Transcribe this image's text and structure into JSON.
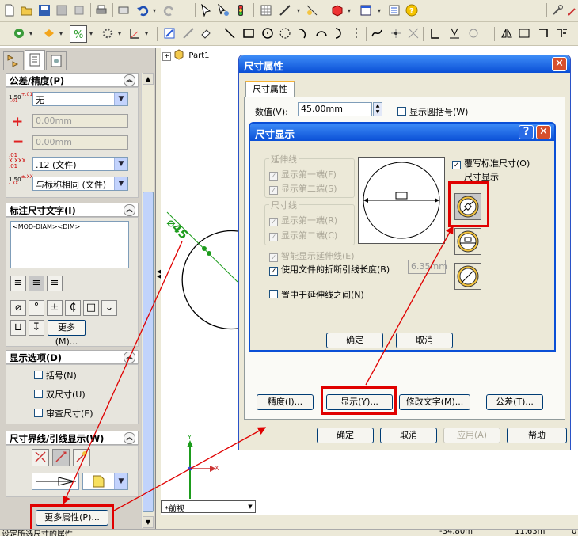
{
  "toolbar": {
    "top_icons": [
      "new-icon",
      "open-icon",
      "save-icon",
      "print-icon",
      "undo-icon",
      "redo-icon",
      "select-icon",
      "rebuild-icon",
      "options-icon",
      "help-icon"
    ],
    "sketch_icons": [
      "line-icon",
      "rectangle-icon",
      "circle-icon",
      "arc-icon",
      "spline-icon",
      "point-icon"
    ]
  },
  "tabs": {
    "feature_manager": "feature-manager-icon",
    "property_manager": "property-manager-icon",
    "config_manager": "configuration-manager-icon"
  },
  "tolerance": {
    "title": "公差/精度(P)",
    "tolerance_type": "无",
    "upper": "0.00mm",
    "lower": "0.00mm",
    "precision": ".12 (文件)",
    "tolerance_precision": "与标称相同 (文件)",
    "icon_label_1": "1.50",
    "icon_label_4": "1.50"
  },
  "dim_text": {
    "title": "标注尺寸文字(I)",
    "text": "<MOD-DIAM><DIM>",
    "more_button": "更多(M)..."
  },
  "display_options": {
    "title": "显示选项(D)",
    "parentheses": "括号(N)",
    "dual_dim": "双尺寸(U)",
    "inspection": "审查尺寸(E)"
  },
  "witness": {
    "title": "尺寸界线/引线显示(W)"
  },
  "more_properties_button": "更多属性(P)...",
  "status_bar": {
    "left": "设定所选尺寸的属性",
    "coord1": "-34.80m",
    "coord2": "11.63m",
    "coord3": "0"
  },
  "tree": {
    "part_name": "Part1",
    "expand": "+"
  },
  "view_dropdown": "*前视",
  "graphics": {
    "dimension_text": "⌀45",
    "axis_y": "Y",
    "axis_x": "X"
  },
  "dim_props": {
    "title": "尺寸属性",
    "tab": "尺寸属性",
    "value_label": "数值(V):",
    "value": "45.00mm",
    "round_brackets": "显示圆括号(W)",
    "precision_button": "精度(I)...",
    "display_button": "显示(Y)...",
    "modify_text_button": "修改文字(M)...",
    "tolerance_button": "公差(T)...",
    "ok": "确定",
    "cancel": "取消",
    "apply": "应用(A)",
    "help": "帮助"
  },
  "dim_display": {
    "title": "尺寸显示",
    "help": "?",
    "extension_group": "延伸线",
    "ext_show_first": "显示第一端(F)",
    "ext_show_second": "显示第二端(S)",
    "dim_group": "尺寸线",
    "dim_show_first": "显示第一端(R)",
    "dim_show_second": "显示第二端(C)",
    "override": "覆写标准尺寸(O)",
    "dim_display_label": "尺寸显示",
    "smart_ext": "智能显示延伸线(E)",
    "use_file_break": "使用文件的折断引线长度(B)",
    "break_length": "6.35mm",
    "center_between": "置中于延伸线之间(N)",
    "ok": "确定",
    "cancel": "取消"
  },
  "colors": {
    "title_blue": "#0a4fd6",
    "title_blue_light": "#3d8cf7",
    "annotation_red": "#e00000",
    "dimension_green": "#1d9c1d"
  }
}
